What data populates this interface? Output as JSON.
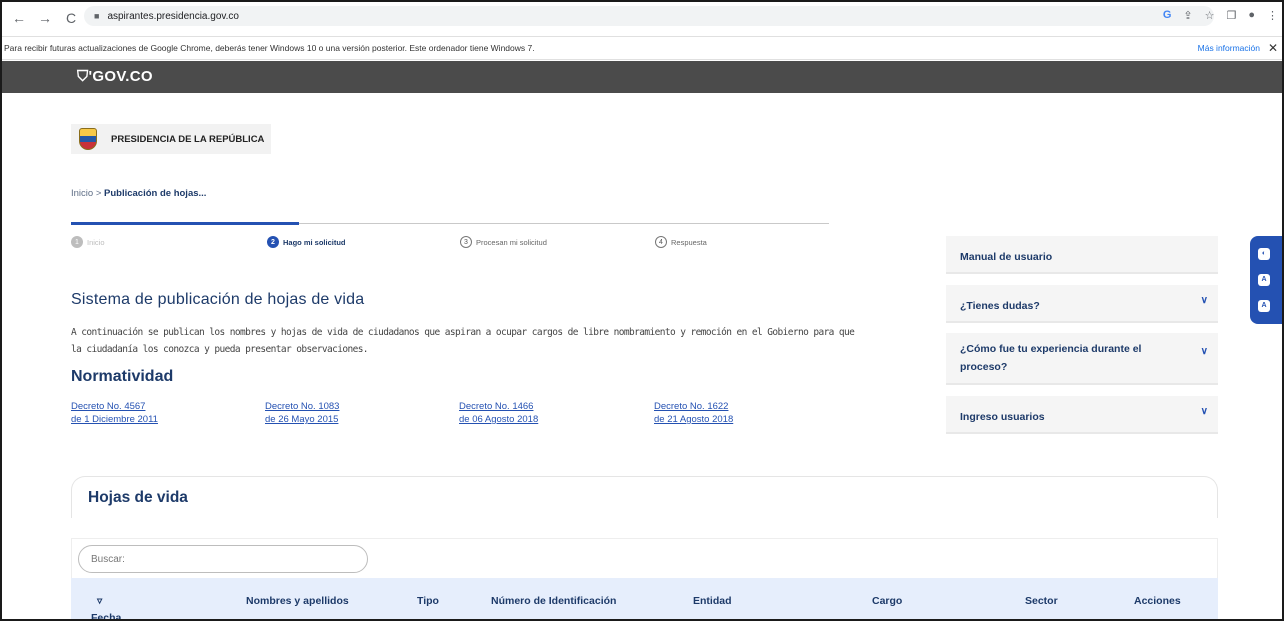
{
  "browser": {
    "url": "aspirantes.presidencia.gov.co",
    "nav": {
      "back": "←",
      "forward": "→",
      "reload": "C"
    },
    "toolbar_icons": [
      "G",
      "⇪",
      "☆",
      "❐",
      "●",
      "⋮"
    ]
  },
  "infobar": {
    "message": "Para recibir futuras actualizaciones de Google Chrome, deberás tener Windows 10 o una versión posterior. Este ordenador tiene Windows 7.",
    "more_link": "Más información",
    "close": "✕"
  },
  "govbar": {
    "logo": "⛉'GOV.CO"
  },
  "header": {
    "entity": "PRESIDENCIA DE LA REPÚBLICA"
  },
  "breadcrumb": {
    "home": "Inicio",
    "sep": " > ",
    "current": "Publicación de hojas..."
  },
  "stepper": [
    {
      "num": "1",
      "label": "Inicio"
    },
    {
      "num": "2",
      "label": "Hago mi solicitud"
    },
    {
      "num": "3",
      "label": "Procesan mi solicitud"
    },
    {
      "num": "4",
      "label": "Respuesta"
    }
  ],
  "main": {
    "title": "Sistema de publicación de hojas de vida",
    "description": "A continuación se publican los nombres y hojas de vida de ciudadanos que aspiran a ocupar cargos de libre nombramiento y remoción en el Gobierno para que la ciudadanía los conozca y pueda presentar observaciones.",
    "norm_title": "Normatividad",
    "decrees": [
      {
        "line1": "Decreto No. 4567",
        "line2": "de 1 Diciembre 2011"
      },
      {
        "line1": "Decreto No. 1083",
        "line2": "de 26 Mayo 2015"
      },
      {
        "line1": "Decreto No. 1466",
        "line2": "de 06 Agosto 2018"
      },
      {
        "line1": "Decreto No. 1622",
        "line2": "de 21 Agosto 2018"
      }
    ]
  },
  "sidebar": {
    "manual": "Manual de usuario",
    "dudas": "¿Tienes dudas?",
    "experiencia": "¿Cómo fue tu experiencia durante el proceso?",
    "ingreso": "Ingreso usuarios",
    "chevron": "∨"
  },
  "accessibility": {
    "contrast": "◐",
    "font_down": "A",
    "font_up": "A"
  },
  "cv_section": {
    "title": "Hojas de vida",
    "search_placeholder": "Buscar:",
    "sort_icon": "▿",
    "columns": [
      "Fecha Publicación",
      "Nombres y apellidos",
      "Tipo",
      "Número de Identificación",
      "Entidad",
      "Cargo",
      "Sector",
      "Acciones"
    ]
  }
}
